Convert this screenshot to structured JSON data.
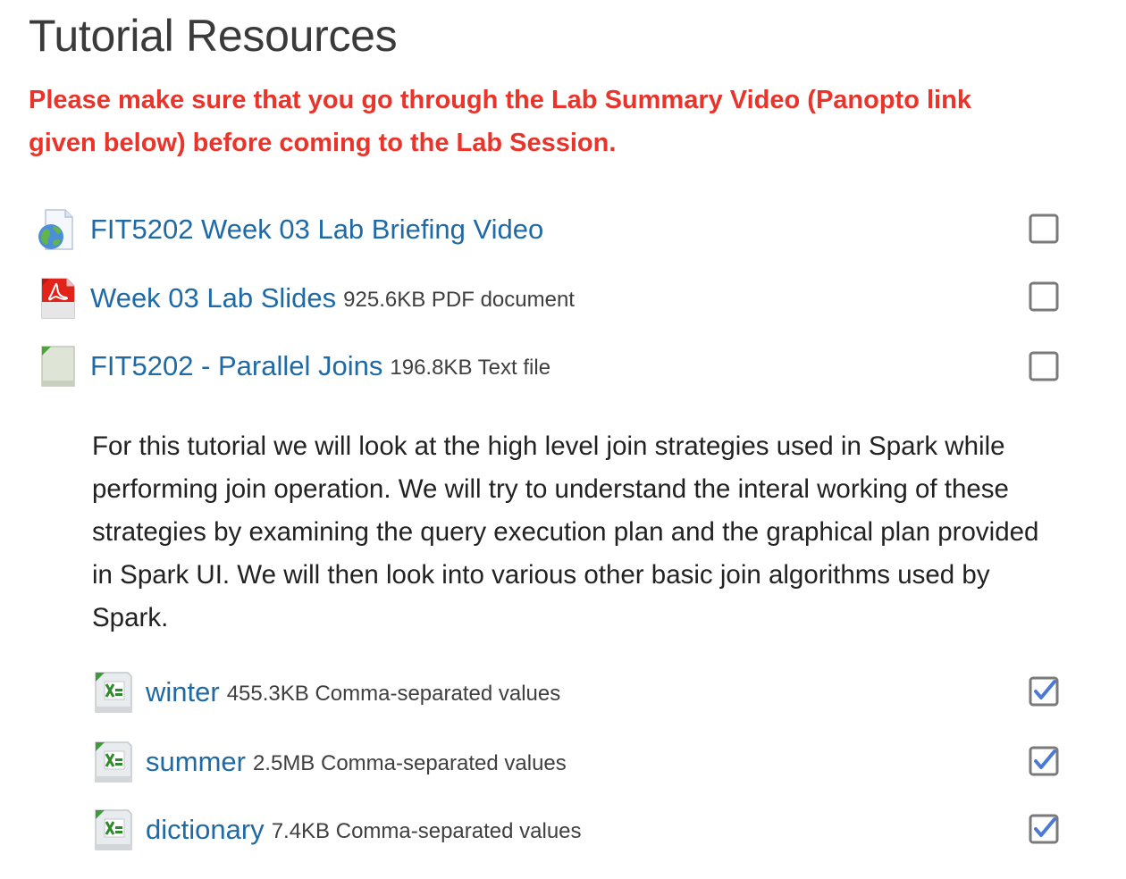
{
  "section": {
    "title": "Tutorial Resources",
    "notice": "Please make sure that you go through the Lab Summary Video (Panopto link given below) before coming to the Lab Session."
  },
  "activities": [
    {
      "name": "FIT5202 Week 03 Lab Briefing Video",
      "info": "",
      "icon": "url-globe-icon",
      "completed": false
    },
    {
      "name": "Week 03 Lab Slides",
      "info": "925.6KB PDF document",
      "icon": "pdf-file-icon",
      "completed": false
    },
    {
      "name": "FIT5202 - Parallel Joins",
      "info": "196.8KB Text file",
      "icon": "text-file-icon",
      "completed": false
    }
  ],
  "summary": "For this tutorial we will look at the high level join strategies used in Spark while performing join operation. We will try to understand the interal working of these strategies by examining the query execution plan and the graphical plan provided in Spark UI. We will then look into various other basic join algorithms used by Spark.",
  "files": [
    {
      "name": "winter",
      "info": "455.3KB Comma-separated values",
      "icon": "spreadsheet-file-icon",
      "completed": true
    },
    {
      "name": "summer",
      "info": "2.5MB Comma-separated values",
      "icon": "spreadsheet-file-icon",
      "completed": true
    },
    {
      "name": "dictionary",
      "info": "7.4KB Comma-separated values",
      "icon": "spreadsheet-file-icon",
      "completed": true
    }
  ],
  "colors": {
    "link": "#1f6aa5",
    "notice": "#e8342a",
    "checkmark": "#4a7ad6",
    "checkbox_border": "#7a7a7a"
  }
}
